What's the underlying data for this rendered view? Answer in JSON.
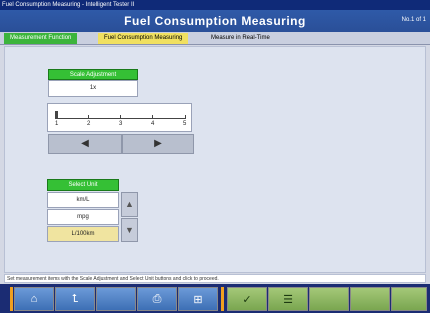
{
  "window": {
    "titlebar_text": "Fuel Consumption Measuring - Intelligent Tester II",
    "header_title": "Fuel Consumption Measuring",
    "header_code": "No.1 of 1"
  },
  "tabs": [
    {
      "label": "Measurement Function"
    },
    {
      "label": "Fuel Consumption Measuring"
    },
    {
      "label": "Measure in Real-Time"
    }
  ],
  "scale_panel": {
    "header": "Scale Adjustment",
    "value": "1x",
    "ticks": [
      "1",
      "2",
      "3",
      "4",
      "5"
    ],
    "prev_label": "◀",
    "next_label": "▶"
  },
  "select_panel": {
    "header": "Select Unit",
    "items": [
      "km/L",
      "mpg",
      "L/100km"
    ],
    "selected_index": 2
  },
  "status_text": "Set measurement items with the Scale Adjustment and Select Unit buttons and click to proceed.",
  "colors": {
    "header": "#2f5aa8",
    "toolbar": "#1b2c73",
    "panel_green": "#35c035",
    "selected": "#f0e4a0"
  },
  "toolbar": {
    "home_icon": "⌂",
    "back_icon": "⮤",
    "print_icon": "⎙",
    "save_icon": "⊞",
    "check_icon": "✓",
    "list_icon": "☰"
  }
}
